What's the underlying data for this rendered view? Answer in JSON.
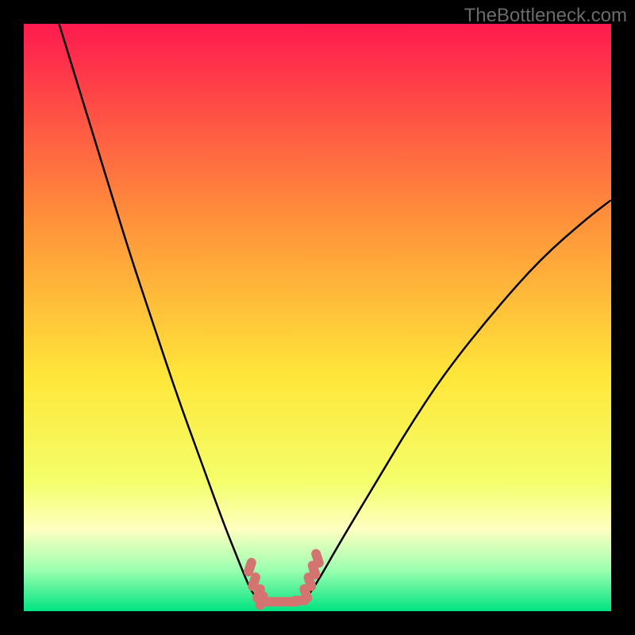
{
  "watermark": "TheBottleneck.com",
  "colors": {
    "top": "#ff1a4f",
    "mid_upper": "#ff903b",
    "mid": "#ffe63a",
    "mid_lower": "#f4ff6a",
    "pale_yellow": "#ffffc0",
    "light_green": "#9cffb0",
    "green": "#00e381",
    "curve": "#000000",
    "marker": "#d47471",
    "frame": "#000000"
  },
  "chart_data": {
    "type": "line",
    "title": "",
    "xlabel": "",
    "ylabel": "",
    "xlim": [
      0,
      100
    ],
    "ylim": [
      0,
      100
    ],
    "series": [
      {
        "name": "left-branch",
        "x": [
          6,
          10,
          14,
          18,
          22,
          26,
          30,
          34,
          36,
          38,
          39,
          40
        ],
        "y": [
          100,
          87,
          74,
          61,
          49,
          37,
          26,
          15,
          10,
          5,
          3,
          2
        ]
      },
      {
        "name": "floor",
        "x": [
          40,
          44,
          48
        ],
        "y": [
          2,
          2,
          2
        ]
      },
      {
        "name": "right-branch",
        "x": [
          48,
          50,
          54,
          60,
          66,
          72,
          80,
          88,
          96,
          100
        ],
        "y": [
          2,
          5,
          12,
          22,
          32,
          41,
          51,
          60,
          67,
          70
        ]
      },
      {
        "name": "markers-left",
        "x": [
          38.5,
          39.2,
          40.0,
          40.5
        ],
        "y": [
          7.5,
          5.0,
          3.0,
          1.8
        ]
      },
      {
        "name": "markers-floor",
        "x": [
          41.5,
          43.5,
          45.5,
          47.0
        ],
        "y": [
          1.6,
          1.6,
          1.6,
          1.8
        ]
      },
      {
        "name": "markers-right",
        "x": [
          48.0,
          48.7,
          49.4,
          50.0
        ],
        "y": [
          3.0,
          5.0,
          7.0,
          9.0
        ]
      }
    ],
    "gradient_stops": [
      {
        "pct": 0,
        "color": "#ff1a4f"
      },
      {
        "pct": 33,
        "color": "#ff903b"
      },
      {
        "pct": 60,
        "color": "#ffe63a"
      },
      {
        "pct": 78,
        "color": "#f4ff6a"
      },
      {
        "pct": 86,
        "color": "#ffffc0"
      },
      {
        "pct": 93,
        "color": "#9cffb0"
      },
      {
        "pct": 100,
        "color": "#00e381"
      }
    ]
  }
}
